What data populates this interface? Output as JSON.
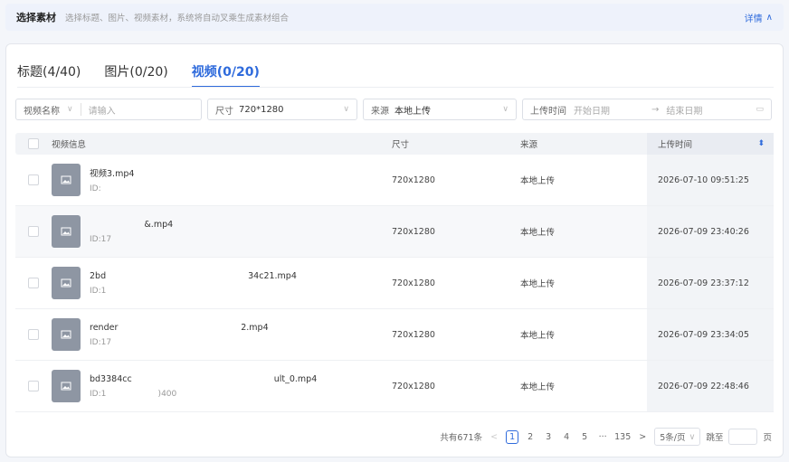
{
  "header": {
    "title": "选择素材",
    "description": "选择标题、图片、视频素材，系统将自动叉乘生成素材组合",
    "detail_label": "详情",
    "detail_icon": "chevron-up-icon"
  },
  "tabs": [
    {
      "label": "标题(4/40)",
      "active": false
    },
    {
      "label": "图片(0/20)",
      "active": false
    },
    {
      "label": "视频(0/20)",
      "active": true
    }
  ],
  "filters": {
    "field_select": "视频名称",
    "search_placeholder": "请输入",
    "size_label": "尺寸",
    "size_value": "720*1280",
    "source_label": "来源",
    "source_value": "本地上传",
    "date_label": "上传时间",
    "start_placeholder": "开始日期",
    "end_placeholder": "结束日期"
  },
  "table": {
    "headers": {
      "info": "视频信息",
      "size": "尺寸",
      "source": "来源",
      "time": "上传时间"
    },
    "rows": [
      {
        "name": "视频3.mp4",
        "id": "ID:",
        "size": "720x1280",
        "source": "本地上传",
        "time": "2026-07-10 09:51:25"
      },
      {
        "name": "                    &.mp4",
        "id": "ID:17",
        "size": "720x1280",
        "source": "本地上传",
        "time": "2026-07-09 23:40:26"
      },
      {
        "name": "2bd                                                    34c21.mp4",
        "id": "ID:1",
        "size": "720x1280",
        "source": "本地上传",
        "time": "2026-07-09 23:37:12"
      },
      {
        "name": "render                                             2.mp4",
        "id": "ID:17",
        "size": "720x1280",
        "source": "本地上传",
        "time": "2026-07-09 23:34:05"
      },
      {
        "name": "bd3384cc                                                    ult_0.mp4",
        "id": "ID:1                    )400",
        "size": "720x1280",
        "source": "本地上传",
        "time": "2026-07-09 22:48:46"
      }
    ]
  },
  "pagination": {
    "total": "共有671条",
    "pages": [
      "1",
      "2",
      "3",
      "4",
      "5",
      "···",
      "135"
    ],
    "current": "1",
    "page_size": "5条/页",
    "jump_label": "跳至",
    "page_unit": "页"
  },
  "colors": {
    "accent": "#2f6bdc",
    "thumb": "#8e96a3"
  }
}
